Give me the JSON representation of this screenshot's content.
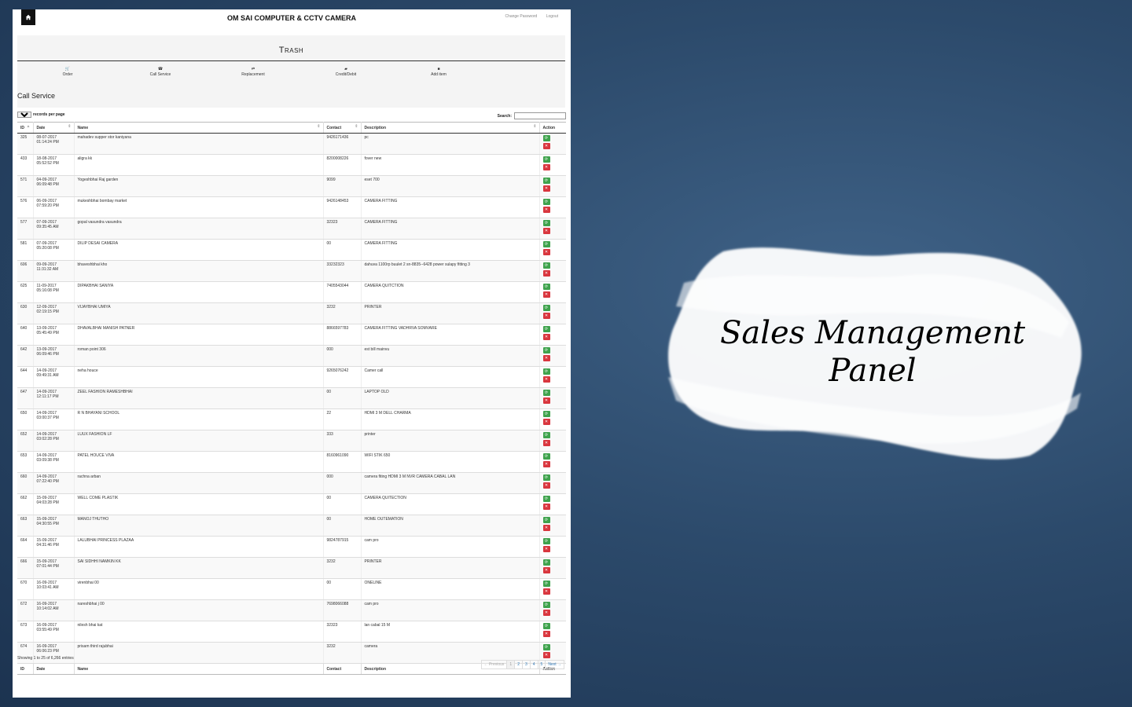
{
  "app": {
    "title": "OM SAI COMPUTER & CCTV CAMERA",
    "links": [
      "Change Password",
      "Logout"
    ],
    "page_title": "Trash"
  },
  "menu": [
    {
      "label": "Order",
      "icon": "cart-icon",
      "glyph": "🛒"
    },
    {
      "label": "Call Service",
      "icon": "phone-icon",
      "glyph": "☎"
    },
    {
      "label": "Replacement",
      "icon": "swap-icon",
      "glyph": "⇄"
    },
    {
      "label": "Credit/Debit",
      "icon": "wallet-icon",
      "glyph": "▰"
    },
    {
      "label": "Add item",
      "icon": "camera-icon",
      "glyph": "■"
    }
  ],
  "section_title": "Call Service",
  "length": {
    "value": "25",
    "label": "records per page"
  },
  "search": {
    "label": "Search:",
    "value": ""
  },
  "table": {
    "columns": [
      "ID",
      "Date",
      "Name",
      "Contact",
      "Description",
      "Action"
    ],
    "rows": [
      {
        "id": "325",
        "date": "08-07-2017",
        "time": "01:14:24 PM",
        "name": "mahadev supper stor kaniyana",
        "contact": "9426171436",
        "desc": "pc"
      },
      {
        "id": "433",
        "date": "18-08-2017",
        "time": "05:52:52 PM",
        "name": "aligra kk",
        "contact": "8200008226",
        "desc": "fover new"
      },
      {
        "id": "571",
        "date": "04-09-2017",
        "time": "06:09:48 PM",
        "name": "Yogeshbhai Raj garden",
        "contact": "9099",
        "desc": "eset 700"
      },
      {
        "id": "576",
        "date": "06-09-2017",
        "time": "07:59:20 PM",
        "name": "mukeshbhai bombay market",
        "contact": "9426148453",
        "desc": "CAMERA FITTING"
      },
      {
        "id": "577",
        "date": "07-09-2017",
        "time": "09:35:45 AM",
        "name": "gopal vasundra vasundra",
        "contact": "32323",
        "desc": "CAMERA FITTING"
      },
      {
        "id": "581",
        "date": "07-09-2017",
        "time": "05:20:08 PM",
        "name": "DILIP DESAI CAMERA",
        "contact": "00",
        "desc": "CAMERA FITTING"
      },
      {
        "id": "606",
        "date": "09-09-2017",
        "time": "11:31:32 AM",
        "name": "bhaveshbhai kho",
        "contact": "33232323",
        "desc": "dahuva 1100rp buulet 2 sn-8835--6428 power sulapy fitting 3"
      },
      {
        "id": "625",
        "date": "11-09-2017",
        "time": "05:16:08 PM",
        "name": "DIPAKBHAI SANIYA",
        "contact": "7405543044",
        "desc": "CAMERA QUITCTION"
      },
      {
        "id": "630",
        "date": "12-09-2017",
        "time": "02:19:15 PM",
        "name": "VIJAYBHAI UMIYA",
        "contact": "3232",
        "desc": "PRINTER"
      },
      {
        "id": "640",
        "date": "13-09-2017",
        "time": "05:45:49 PM",
        "name": "DHAVALBHAI MANISH PATNER",
        "contact": "8866597783",
        "desc": "CAMERA FITTING VADHRVA SOMVARE"
      },
      {
        "id": "642",
        "date": "13-09-2017",
        "time": "06:09:46 PM",
        "name": "roman point 306",
        "contact": "000",
        "desc": "est bill mainvu"
      },
      {
        "id": "644",
        "date": "14-09-2017",
        "time": "09:49:31 AM",
        "name": "neha houce",
        "contact": "9265076242",
        "desc": "Camer call"
      },
      {
        "id": "647",
        "date": "14-09-2017",
        "time": "12:11:17 PM",
        "name": "ZEEL FASHION RAMESHBHAI",
        "contact": "00",
        "desc": "LAPTOP OLD"
      },
      {
        "id": "650",
        "date": "14-09-2017",
        "time": "03:00:37 PM",
        "name": "R N BHAYANI SCHOOL",
        "contact": "22",
        "desc": "HDMI 3 M DELL CHARMA"
      },
      {
        "id": "652",
        "date": "14-09-2017",
        "time": "03:02:28 PM",
        "name": "LUUX FASHION LF",
        "contact": "333",
        "desc": "printer"
      },
      {
        "id": "653",
        "date": "14-09-2017",
        "time": "03:09:38 PM",
        "name": "PATEL HOUCE VIVA",
        "contact": "8160961090",
        "desc": "WIFI STIK 650"
      },
      {
        "id": "660",
        "date": "14-09-2017",
        "time": "07:22:40 PM",
        "name": "rachna arban",
        "contact": "000",
        "desc": "camera fiting HDMI 3 M NVR CAMERA CABAL LAN"
      },
      {
        "id": "662",
        "date": "15-09-2017",
        "time": "04:03:28 PM",
        "name": "WELL COME PLASTIK",
        "contact": "00",
        "desc": "CAMERA QUITECTION"
      },
      {
        "id": "663",
        "date": "15-09-2017",
        "time": "04:30:55 PM",
        "name": "MANOJ THUTHO",
        "contact": "00",
        "desc": "HOME OUTEMATION"
      },
      {
        "id": "664",
        "date": "15-09-2017",
        "time": "04:31:46 PM",
        "name": "LALUBHAI PRINCESS PLAZAA",
        "contact": "9824787915",
        "desc": "cam pro"
      },
      {
        "id": "666",
        "date": "15-09-2017",
        "time": "07:01:44 PM",
        "name": "SAI SIDHHI NAMKIN KK",
        "contact": "3232",
        "desc": "PRINTER"
      },
      {
        "id": "670",
        "date": "16-09-2017",
        "time": "10:03:41 AM",
        "name": "virenbhai 00",
        "contact": "00",
        "desc": "ONELINE"
      },
      {
        "id": "672",
        "date": "16-09-2017",
        "time": "10:14:02 AM",
        "name": "nareshbhai j 00",
        "contact": "7698066088",
        "desc": "cam pro"
      },
      {
        "id": "673",
        "date": "16-09-2017",
        "time": "03:55:49 PM",
        "name": "nilesh bhai kat",
        "contact": "32323",
        "desc": "lan cabal 15 M"
      },
      {
        "id": "674",
        "date": "16-09-2017",
        "time": "06:06:23 PM",
        "name": "prisam third rajubhai",
        "contact": "3232",
        "desc": "camera"
      }
    ]
  },
  "info": "Showing 1 to 25 of 6,266 entries",
  "pager": [
    "← Previous",
    "1",
    "2",
    "3",
    "4",
    "5",
    "Next →"
  ],
  "promo": {
    "line1": "Sales Management",
    "line2": "Panel"
  }
}
